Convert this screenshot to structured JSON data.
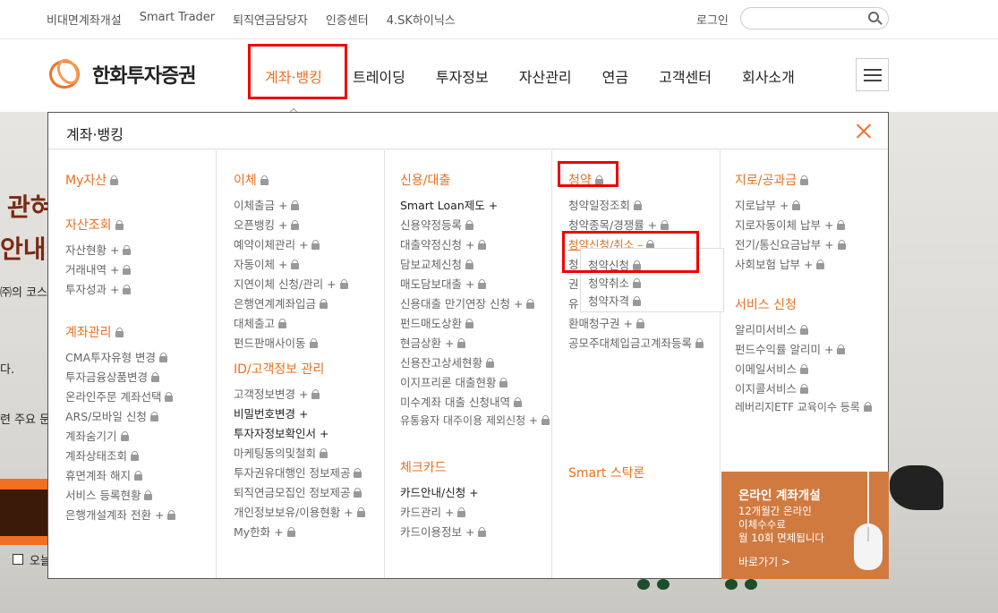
{
  "util": {
    "links": [
      "비대면계좌개설",
      "Smart Trader",
      "퇴직연금담당자",
      "인증센터",
      "4.SK하이닉스"
    ],
    "login": "로그인",
    "search_placeholder": ""
  },
  "header": {
    "logo_text": "한화투자증권",
    "nav": [
      "계좌·뱅킹",
      "트레이딩",
      "투자정보",
      "자산관리",
      "연금",
      "고객센터",
      "회사소개"
    ]
  },
  "background": {
    "headline1": "관혀",
    "headline2": "안내",
    "line1": "㈜의 코스",
    "line2": "다.",
    "line3": "련 주요 문",
    "checkbox_label": "오늘"
  },
  "panel": {
    "title": "계좌·뱅킹",
    "col1": {
      "s1": "My자산",
      "s2": "자산조회",
      "s2_items": [
        "자산현황 +",
        "거래내역 +",
        "투자성과 +"
      ],
      "s3": "계좌관리",
      "s3_items": [
        "CMA투자유형 변경",
        "투자금융상품변경",
        "온라인주문 계좌선택",
        "ARS/모바일 신청",
        "계좌숨기기",
        "계좌상태조회",
        "휴면계좌 해지",
        "서비스 등록현황",
        "은행개설계좌 전환 +"
      ]
    },
    "col2": {
      "s1": "이체",
      "s1_items": [
        "이체출금 +",
        "오픈뱅킹 +",
        "예약이체관리 +",
        "자동이체 +",
        "지연이체 신청/관리 +",
        "은행연계계좌입금",
        "대체출고",
        "펀드판매사이동"
      ],
      "s2": "ID/고객정보 관리",
      "s2_items": [
        "고객정보변경 +",
        "비밀번호변경 +",
        "투자자정보확인서 +",
        "마케팅동의및철회",
        "투자권유대행인 정보제공",
        "퇴직연금모집인 정보제공",
        "개인정보보유/이용현황 +",
        "My한화 +"
      ]
    },
    "col3": {
      "s1": "신용/대출",
      "s1_items": [
        "Smart Loan제도 +",
        "신용약정등록",
        "대출약정신청 +",
        "담보교체신청",
        "매도담보대출 +",
        "신용대출 만기연장 신청 +",
        "펀드매도상환",
        "현금상환 +",
        "신용잔고상세현황",
        "이지프리론 대출현황",
        "미수계좌 대출 신청내역",
        "유통융자 대주이용 제외신청 +"
      ],
      "s2": "체크카드",
      "s2_items": [
        "카드안내/신청 +",
        "카드관리 +",
        "카드이용정보 +"
      ]
    },
    "col4": {
      "s1": "청약",
      "items_a": [
        "청약일정조회",
        "청약종목/경쟁률 +"
      ],
      "apply_cancel": "청약신청/취소 –",
      "hidden_prefix": [
        "청",
        "권",
        "유"
      ],
      "sub_items": [
        "청약신청",
        "청약취소",
        "청약자격"
      ],
      "items_b": [
        "환매청구권 +",
        "공모주대체입금고계좌등록"
      ],
      "s2": "Smart 스탁론"
    },
    "col5": {
      "s1": "지로/공과금",
      "s1_items": [
        "지로납부 +",
        "지로자동이체 납부 +",
        "전기/통신요금납부 +",
        "사회보험 납부 +"
      ],
      "s2": "서비스 신청",
      "s2_items": [
        "알리미서비스",
        "펀드수익률 알리미 +",
        "이메일서비스",
        "이지콜서비스",
        "레버리지ETF 교육이수 등록"
      ]
    },
    "promo": {
      "title": "온라인 계좌개설",
      "desc1": "12개월간 온라인",
      "desc2": "이체수수료",
      "desc3": "월 10회 면제됩니다",
      "link": "바로가기 >"
    }
  },
  "colors": {
    "accent": "#f07023",
    "highlight": "#ee0000",
    "promo": "#d07a40"
  },
  "icons": [
    "search-icon",
    "hamburger-icon",
    "close-icon",
    "lock-icon"
  ]
}
